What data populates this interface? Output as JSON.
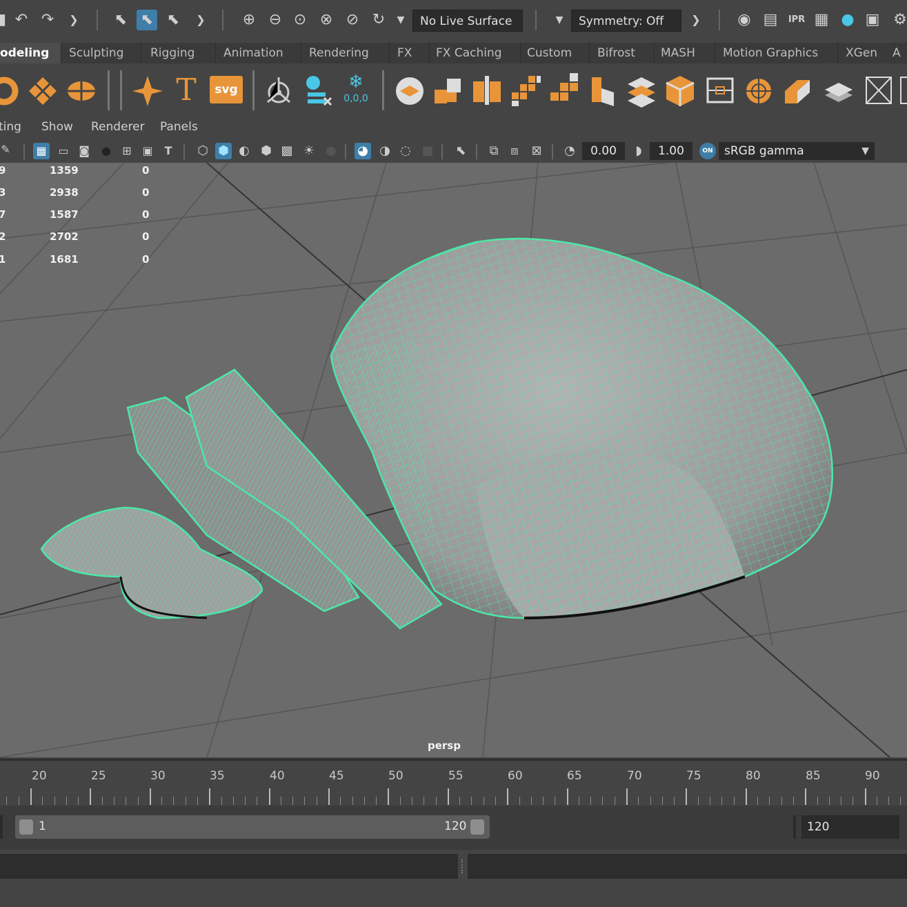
{
  "status_toolbar": {
    "live_surface": "No Live Surface",
    "symmetry": "Symmetry: Off"
  },
  "shelf_tabs": [
    "odeling",
    "Sculpting",
    "Rigging",
    "Animation",
    "Rendering",
    "FX",
    "FX Caching",
    "Custom",
    "Bifrost",
    "MASH",
    "Motion Graphics",
    "XGen",
    "A"
  ],
  "shelf_active_tab": "odeling",
  "shelf_icons": {
    "text_label": "T",
    "svg_label": "svg",
    "snapshot_label": "0,0,0"
  },
  "panel_menu": [
    "ting",
    "Show",
    "Renderer",
    "Panels"
  ],
  "panel_toolbar": {
    "exposure": "0.00",
    "gamma": "1.00",
    "color_mgmt_badge": "ON",
    "color_space": "sRGB gamma"
  },
  "hud": {
    "rows": [
      {
        "a": "9",
        "b": "1359",
        "c": "0"
      },
      {
        "a": "3",
        "b": "2938",
        "c": "0"
      },
      {
        "a": "7",
        "b": "1587",
        "c": "0"
      },
      {
        "a": "2",
        "b": "2702",
        "c": "0"
      },
      {
        "a": "1",
        "b": "1681",
        "c": "0"
      }
    ]
  },
  "viewport": {
    "camera_label": "persp",
    "wire_color": "#4ce8a8",
    "mesh_color": "#9a9a9a"
  },
  "timeline": {
    "labels": [
      "20",
      "25",
      "30",
      "35",
      "40",
      "45",
      "50",
      "55",
      "60",
      "65",
      "70",
      "75",
      "80",
      "85",
      "90"
    ]
  },
  "range": {
    "start": "1",
    "end": "120",
    "anim_end": "120"
  },
  "colors": {
    "accent_orange": "#e8953a",
    "accent_blue": "#3e7ea8"
  }
}
